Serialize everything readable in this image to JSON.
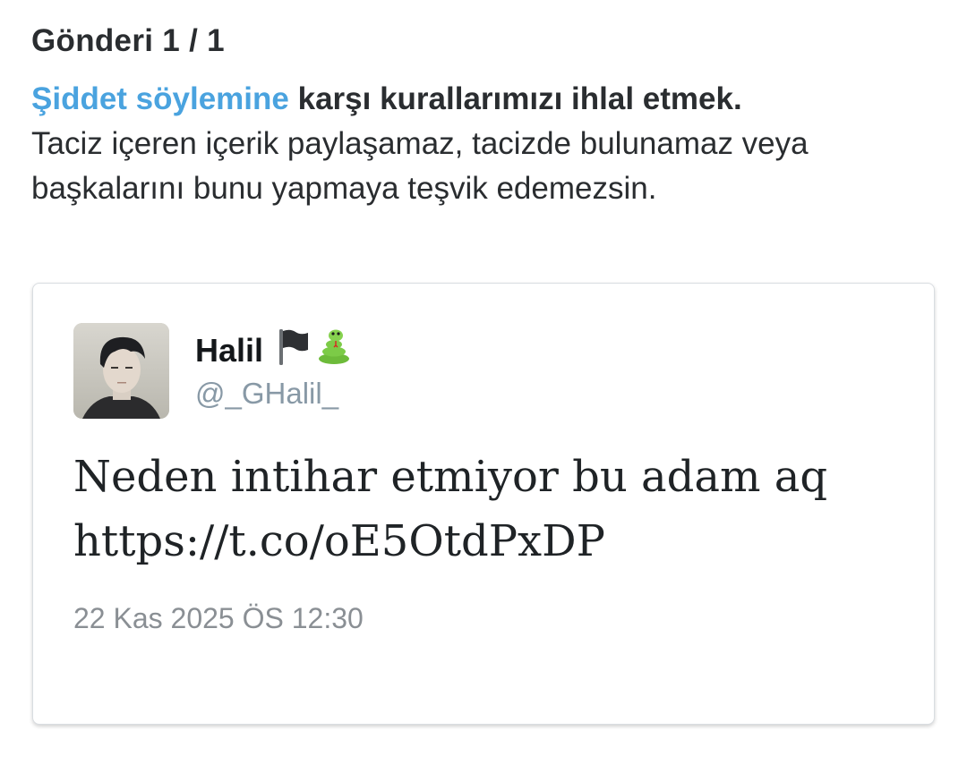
{
  "header": {
    "post_counter": "Gönderi 1 / 1"
  },
  "violation": {
    "policy_link": "Şiddet söylemine",
    "policy_rest": " karşı kurallarımızı ihlal etmek.",
    "description": "Taciz içeren içerik paylaşamaz, tacizde bulunamaz veya başkalarını bunu yapmaya teşvik edemezsin."
  },
  "tweet": {
    "author_name": "Halil",
    "name_emojis": [
      "black-flag-icon",
      "snake-icon"
    ],
    "handle": "@_GHalil_",
    "text": "Neden intihar etmiyor bu adam aq https://t.co/oE5OtdPxDP",
    "timestamp": "22 Kas 2025 ÖS 12:30"
  },
  "colors": {
    "link": "#4aa3df",
    "handle": "#8899a6",
    "timestamp": "#8a8f94",
    "text": "#2a2d30"
  }
}
